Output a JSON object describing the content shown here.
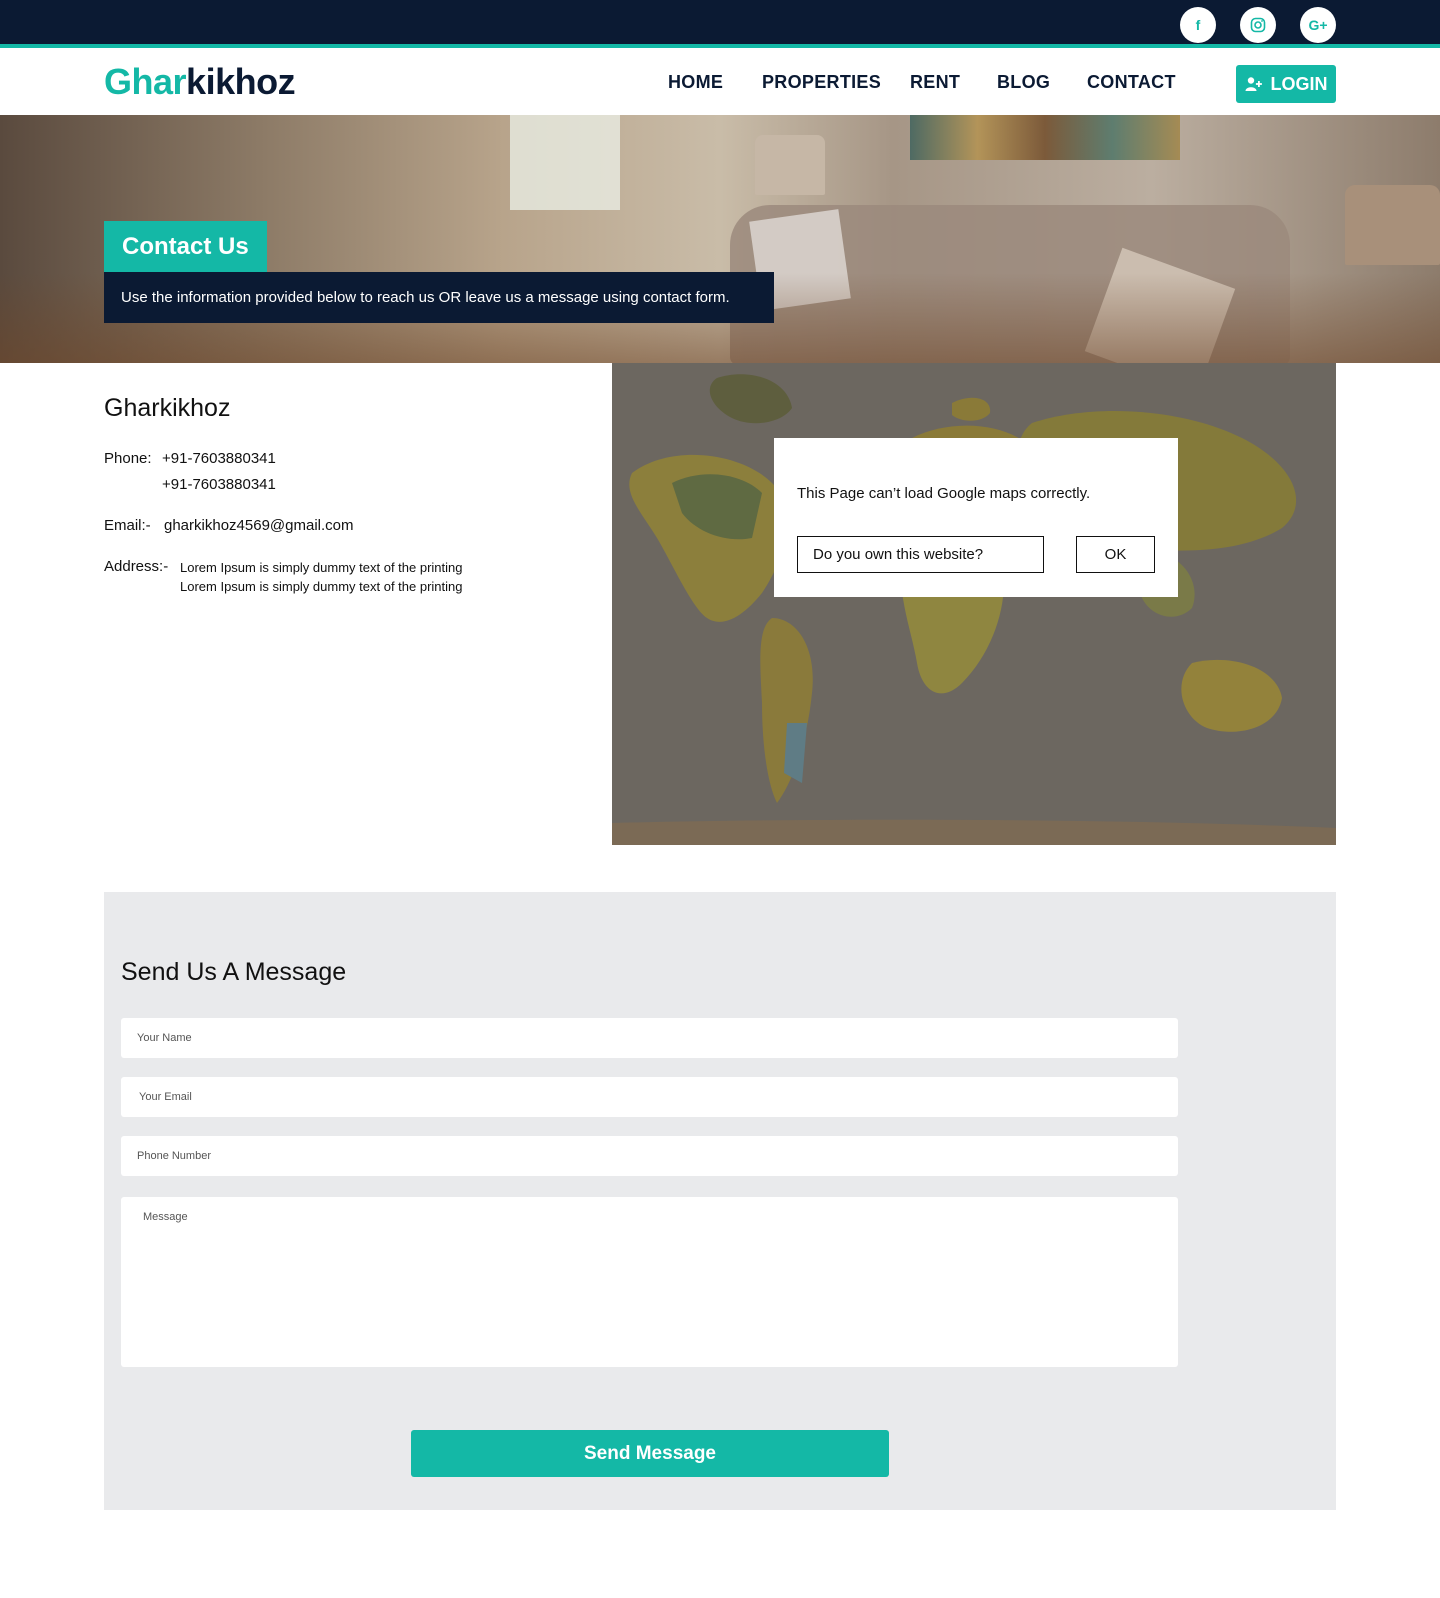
{
  "topbar": {
    "social": [
      {
        "icon": "facebook-icon",
        "glyph": "f"
      },
      {
        "icon": "instagram-icon",
        "glyph": ""
      },
      {
        "icon": "google-plus-icon",
        "glyph": "G+"
      }
    ]
  },
  "header": {
    "logo": {
      "g": "G",
      "har": "har",
      "rest": "kikhoz"
    },
    "nav": [
      "HOME",
      "PROPERTIES",
      "RENT",
      "BLOG",
      "CONTACT"
    ],
    "login_label": "LOGIN"
  },
  "hero": {
    "title": "Contact Us",
    "subtitle": "Use the information provided below to reach us OR leave us a message using contact form."
  },
  "contact": {
    "company": "Gharkikhoz",
    "phone_label": "Phone:",
    "phones": [
      "+91-7603880341",
      "+91-7603880341"
    ],
    "email_label": "Email:-",
    "email": "gharkikhoz4569@gmail.com",
    "address_label": "Address:-",
    "address_lines": [
      "Lorem Ipsum is simply dummy text of the printing",
      "Lorem Ipsum is simply dummy text of the printing"
    ]
  },
  "map": {
    "message": "This Page can’t load Google maps correctly.",
    "own_button": "Do you own this website?",
    "ok_button": "OK"
  },
  "form": {
    "title": "Send Us A Message",
    "name_placeholder": "Your Name",
    "email_placeholder": "Your Email",
    "phone_placeholder": "Phone Number",
    "message_placeholder": "Message",
    "submit_label": "Send Message"
  },
  "colors": {
    "accent": "#14b8a6",
    "navy": "#0b1a33",
    "form_bg": "#e9eaec"
  }
}
